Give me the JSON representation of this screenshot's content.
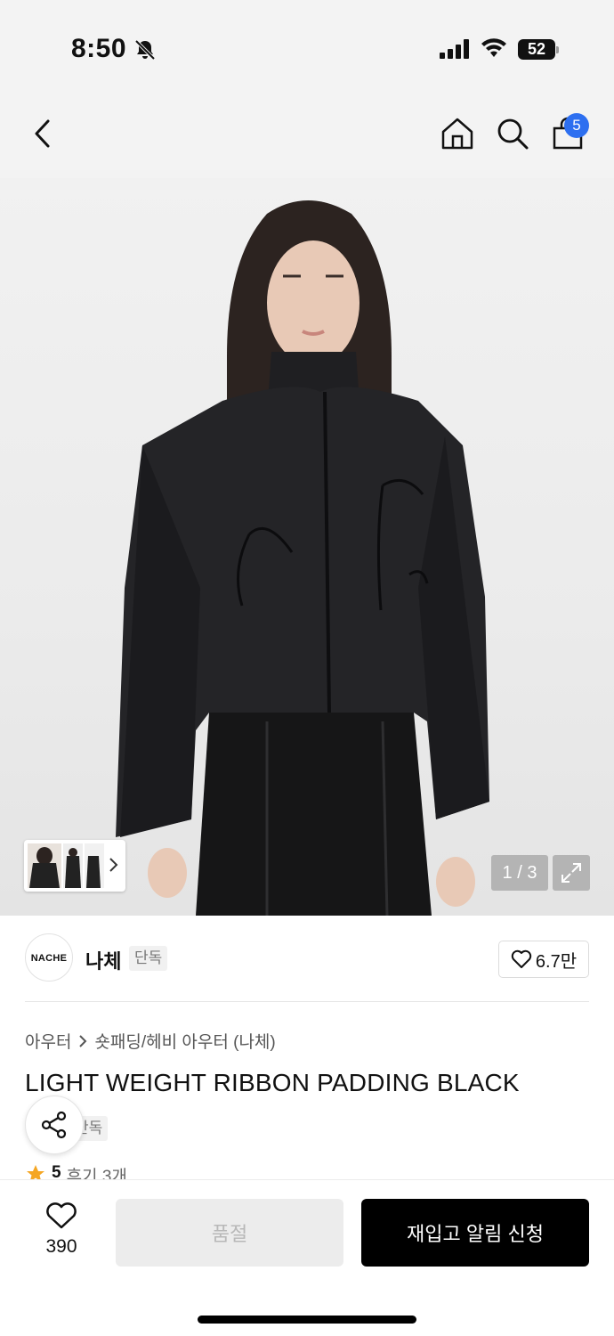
{
  "status_bar": {
    "time": "8:50",
    "battery": "52"
  },
  "nav": {
    "cart_count": "5"
  },
  "gallery": {
    "counter": "1 / 3"
  },
  "brand": {
    "logo_text": "NACHE",
    "name": "나체",
    "tag": "단독",
    "likes": "6.7만"
  },
  "breadcrumb": {
    "category": "아우터",
    "subcategory": "숏패딩/헤비 아우터 (나체)"
  },
  "product": {
    "title": "LIGHT WEIGHT RIBBON PADDING BLACK",
    "exclusive_tag": "단독",
    "rating": "5",
    "reviews": "후기 3개"
  },
  "bottom_bar": {
    "wish_count": "390",
    "soldout_label": "품절",
    "restock_label": "재입고 알림 신청"
  },
  "colors": {
    "badge": "#2d6ff0",
    "star": "#f5a623",
    "primary_button": "#000000"
  }
}
